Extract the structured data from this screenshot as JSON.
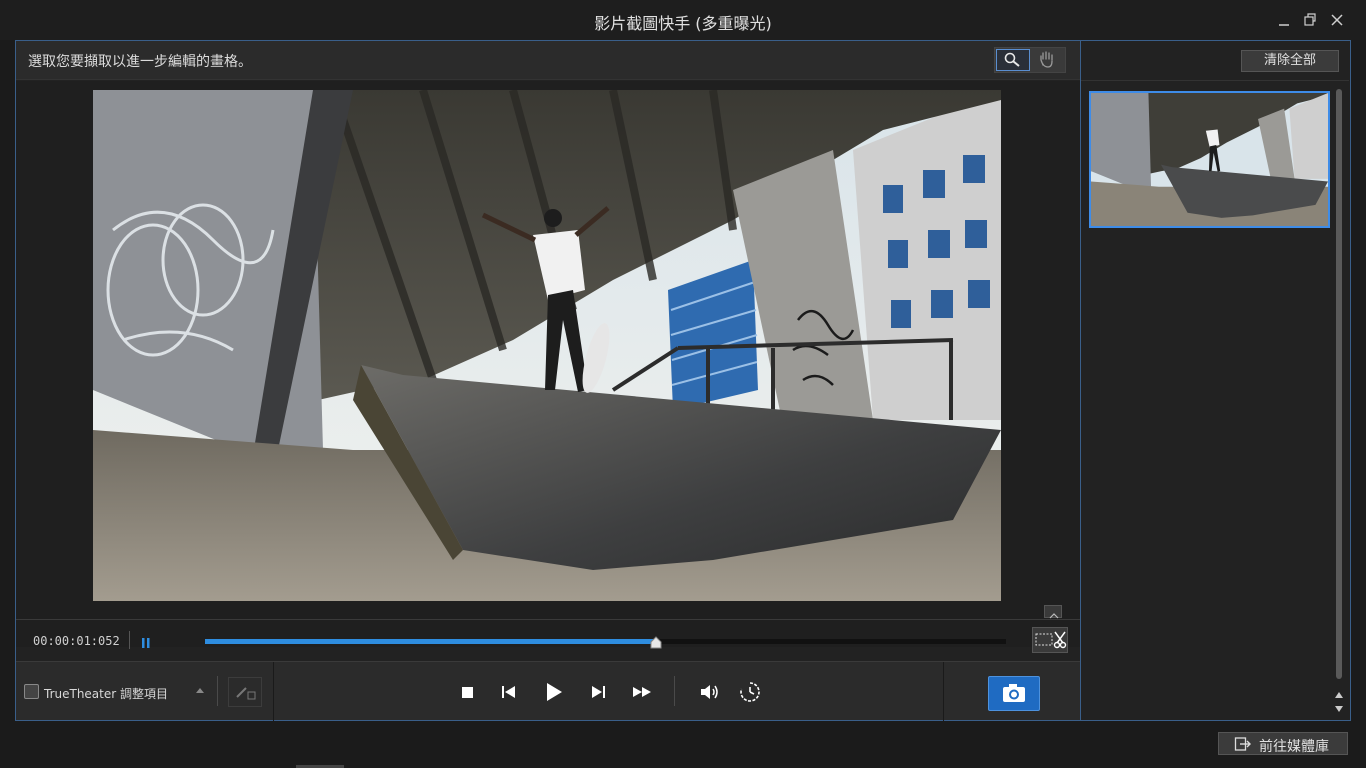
{
  "window": {
    "title": "影片截圖快手 (多重曝光)",
    "minimize_icon": "minimize-icon",
    "restore_icon": "restore-icon",
    "close_icon": "close-icon"
  },
  "instruction": "選取您要擷取以進一步編輯的畫格。",
  "tools": {
    "zoom_icon": "magnifier-icon",
    "pan_icon": "hand-icon",
    "active": "zoom"
  },
  "timeline": {
    "timecode": "00:00:01:052",
    "progress": 0.5625,
    "state": "playing"
  },
  "controls": {
    "truetheater_label": "TrueTheater 調整項目",
    "truetheater_checked": false,
    "buttons": [
      "stop-icon",
      "prev-frame-icon",
      "play-icon",
      "next-frame-icon",
      "fast-forward-icon",
      "volume-icon",
      "speed-icon",
      "camera-icon"
    ]
  },
  "right_panel": {
    "clear_all_label": "清除全部",
    "snapshots": 1
  },
  "footer": {
    "goto_library_label": "前往媒體庫"
  },
  "colors": {
    "accent": "#2e8de0",
    "panel_border": "#3a5f8a",
    "snapshot_button": "#1f6bc2"
  }
}
